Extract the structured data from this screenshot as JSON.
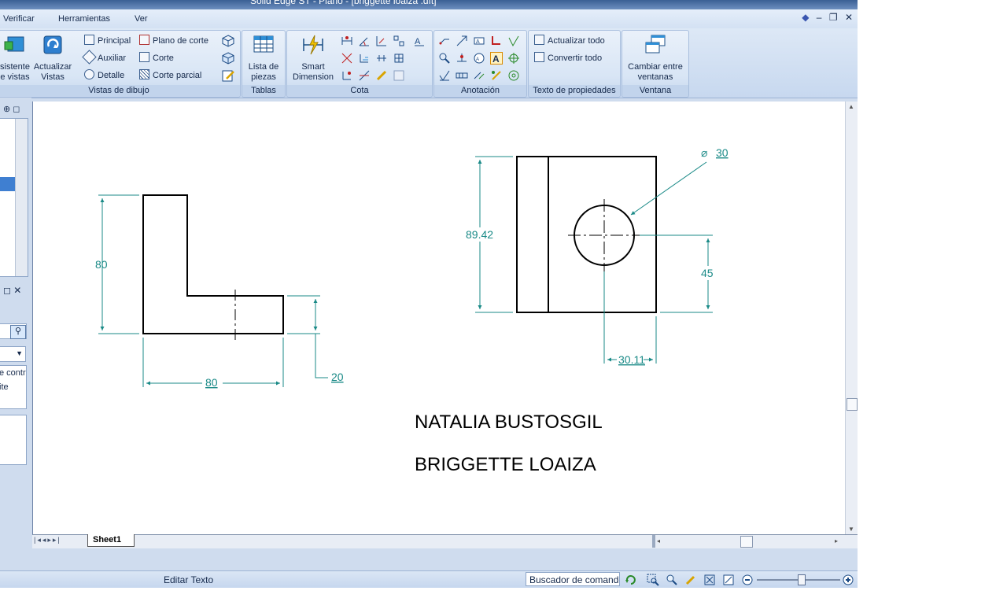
{
  "window": {
    "title": "Solid Edge ST - Plano - [briggette loaiza .dft]"
  },
  "menubar": {
    "items": [
      "Verificar",
      "Herramientas",
      "Ver"
    ]
  },
  "ribbon": {
    "groups": {
      "vistas_de_dibujo": {
        "label": "Vistas de dibujo",
        "asistente": "sistente\ne vistas",
        "actualizar": "Actualizar\nVistas",
        "principal": "Principal",
        "auxiliar": "Auxiliar",
        "detalle": "Detalle",
        "plano_de_corte": "Plano de corte",
        "corte": "Corte",
        "corte_parcial": "Corte parcial"
      },
      "tablas": {
        "label": "Tablas",
        "lista_de_piezas": "Lista de\npiezas"
      },
      "cota": {
        "label": "Cota",
        "smart_dimension": "Smart\nDimension"
      },
      "anotacion": {
        "label": "Anotación"
      },
      "texto_de_propiedades": {
        "label": "Texto de propiedades",
        "actualizar_todo": "Actualizar todo",
        "convertir_todo": "Convertir todo"
      },
      "ventana": {
        "label": "Ventana",
        "cambiar_entre_ventanas": "Cambiar entre\nventanas"
      }
    }
  },
  "left_panel": {
    "fragment_1": "e contr",
    "fragment_2": "ite"
  },
  "drawing": {
    "left_view": {
      "height_dim": "80",
      "width_dim": "80",
      "thickness_dim": "20"
    },
    "right_view": {
      "height_dim": "89.42",
      "hole_diameter_dim": "30",
      "hole_y_dim": "45",
      "hole_x_dim": "30.11"
    },
    "names": [
      "NATALIA BUSTOSGIL",
      "BRIGGETTE LOAIZA"
    ]
  },
  "sheet_tabs": [
    "Sheet1"
  ],
  "status": {
    "text": "Editar Texto",
    "command_finder": "Buscador de comandos"
  },
  "colors": {
    "dimension": "#1a8a87",
    "geometry": "#000000",
    "ribbon_bg": "#d8e5f5"
  }
}
